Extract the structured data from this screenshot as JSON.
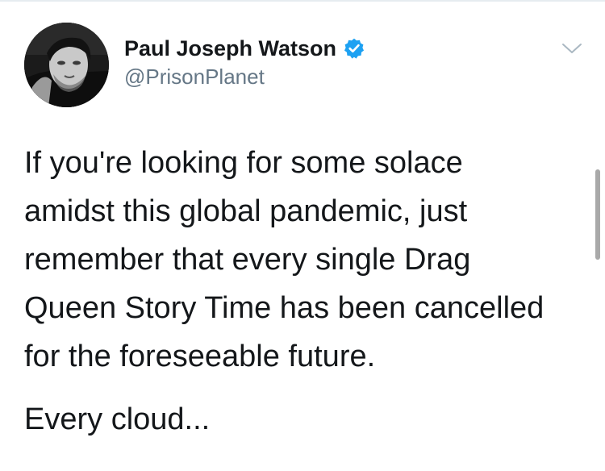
{
  "author": {
    "display_name": "Paul Joseph Watson",
    "handle": "@PrisonPlanet",
    "verified": true,
    "avatar_icon": "profile-photo",
    "verified_icon": "verified-badge-icon"
  },
  "tweet": {
    "text_lines": [
      "If you're looking for some solace",
      "amidst this global pandemic, just",
      "remember that every single Drag",
      "Queen Story Time has been cancelled",
      "for the foreseeable future."
    ],
    "closing": "Every cloud..."
  },
  "menu": {
    "icon": "chevron-down-icon"
  },
  "colors": {
    "text": "#14171a",
    "secondary": "#657786",
    "verified_blue": "#1da1f2",
    "caret": "#aab8c2"
  }
}
